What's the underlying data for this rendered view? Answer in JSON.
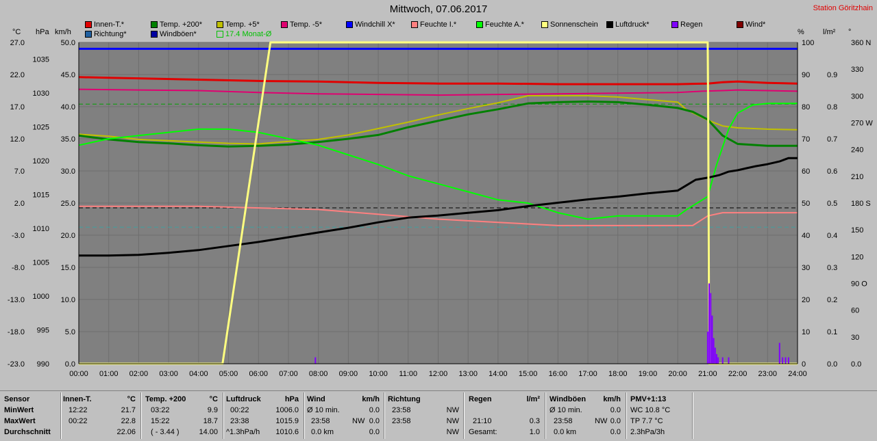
{
  "title": "Mittwoch, 07.06.2017",
  "station": "Station Göritzhain",
  "units": {
    "c": "°C",
    "hpa": "hPa",
    "kmh": "km/h",
    "pct": "%",
    "lm2": "l/m²",
    "deg": "°"
  },
  "legend": [
    {
      "label": "Innen-T.*",
      "color": "#e00000"
    },
    {
      "label": "Temp. +200*",
      "color": "#008000"
    },
    {
      "label": "Temp. +5*",
      "color": "#c0c000"
    },
    {
      "label": "Temp. -5*",
      "color": "#e00070"
    },
    {
      "label": "Windchill X*",
      "color": "#0000ff"
    },
    {
      "label": "Feuchte I.*",
      "color": "#ff8080"
    },
    {
      "label": "Feuchte A.*",
      "color": "#00ff00"
    },
    {
      "label": "Sonnenschein",
      "color": "#ffff80"
    },
    {
      "label": "Luftdruck*",
      "color": "#000000"
    },
    {
      "label": "Regen",
      "color": "#8000ff"
    },
    {
      "label": "Wind*",
      "color": "#800000"
    },
    {
      "label": "Richtung*",
      "color": "#2060a0"
    },
    {
      "label": "Windböen*",
      "color": "#0000a0"
    },
    {
      "label": "17.4 Monat-Ø",
      "color": "#00c000",
      "outline": true
    }
  ],
  "chart_data": {
    "type": "line",
    "x_range": [
      0,
      24
    ],
    "x_ticks": [
      "00:00",
      "01:00",
      "02:00",
      "03:00",
      "04:00",
      "05:00",
      "06:00",
      "07:00",
      "08:00",
      "09:00",
      "10:00",
      "11:00",
      "12:00",
      "13:00",
      "14:00",
      "15:00",
      "16:00",
      "17:00",
      "18:00",
      "19:00",
      "20:00",
      "21:00",
      "22:00",
      "23:00",
      "24:00"
    ],
    "axes": {
      "temp_c": {
        "range": [
          -23,
          27
        ],
        "ticks": [
          "27.0",
          "22.0",
          "17.0",
          "12.0",
          "7.0",
          "2.0",
          "-3.0",
          "-8.0",
          "-13.0",
          "-18.0",
          "-23.0"
        ]
      },
      "pressure_hpa": {
        "range": [
          990,
          1037.5
        ],
        "ticks": [
          "1035",
          "1030",
          "1025",
          "1020",
          "1015",
          "1010",
          "1005",
          "1000",
          "995",
          "990"
        ]
      },
      "wind_kmh": {
        "range": [
          0,
          50
        ],
        "ticks": [
          "50.0",
          "45.0",
          "40.0",
          "35.0",
          "30.0",
          "25.0",
          "20.0",
          "15.0",
          "10.0",
          "5.0",
          "0.0"
        ]
      },
      "humidity_pct": {
        "range": [
          0,
          100
        ],
        "ticks": [
          "100",
          "90",
          "80",
          "70",
          "60",
          "50",
          "40",
          "30",
          "20",
          "10",
          "0"
        ]
      },
      "rain_lm2": {
        "range": [
          0,
          1.0
        ],
        "ticks": [
          "0.9",
          "0.8",
          "0.7",
          "0.6",
          "0.5",
          "0.4",
          "0.3",
          "0.2",
          "0.1",
          "0.0"
        ]
      },
      "direction_deg": {
        "range": [
          0,
          360
        ],
        "ticks": [
          "360 N",
          "330",
          "300",
          "270 W",
          "240",
          "210",
          "180 S",
          "150",
          "120",
          "90 O",
          "60",
          "30",
          "0.0"
        ]
      }
    },
    "grid": true,
    "reference_lines": [
      {
        "axis": "temp_c",
        "value": 17.4,
        "color": "#00a000",
        "dash": true
      },
      {
        "axis": "humidity_pct",
        "value": 48.5,
        "color": "#000000",
        "dash": true
      },
      {
        "axis": "humidity_pct",
        "value": 42.5,
        "color": "#40a0a0",
        "dash": true
      }
    ],
    "series": [
      {
        "name": "Innen-T.*",
        "axis": "temp_c",
        "color": "#e00000",
        "width": 3,
        "x": [
          0,
          1,
          2,
          4,
          6,
          8,
          10,
          12,
          14,
          16,
          18,
          20,
          21,
          21.5,
          22,
          23,
          24
        ],
        "y": [
          21.6,
          21.5,
          21.4,
          21.2,
          21.0,
          20.9,
          20.7,
          20.6,
          20.6,
          20.5,
          20.5,
          20.5,
          20.6,
          20.8,
          20.9,
          20.7,
          20.6
        ]
      },
      {
        "name": "Windböen*",
        "axis": "temp_c",
        "color": "#0000ff",
        "width": 3,
        "x": [
          0,
          24
        ],
        "y": [
          26.0,
          26.0
        ]
      },
      {
        "name": "Temp. -5*",
        "axis": "temp_c",
        "color": "#e00070",
        "width": 2,
        "x": [
          0,
          2,
          4,
          6,
          8,
          10,
          12,
          14,
          16,
          18,
          20,
          20.8,
          21.5,
          22,
          24
        ],
        "y": [
          19.7,
          19.6,
          19.5,
          19.2,
          19.0,
          18.9,
          18.8,
          18.9,
          19.0,
          19.1,
          19.2,
          19.4,
          19.5,
          19.6,
          19.4
        ]
      },
      {
        "name": "Temp. +5*",
        "axis": "temp_c",
        "color": "#c0c000",
        "width": 2,
        "x": [
          0,
          1,
          2,
          3,
          4,
          5,
          6,
          7,
          8,
          9,
          10,
          11,
          12,
          13,
          14,
          15,
          16,
          17,
          18,
          19,
          20,
          20.3,
          21,
          21.5,
          22,
          23,
          24
        ],
        "y": [
          12.7,
          12.4,
          11.9,
          11.7,
          11.5,
          11.3,
          11.2,
          11.6,
          11.9,
          12.6,
          13.6,
          14.6,
          15.7,
          16.7,
          17.6,
          18.7,
          18.7,
          18.7,
          18.5,
          18.1,
          17.7,
          16.5,
          14.9,
          14.0,
          13.7,
          13.5,
          13.4
        ]
      },
      {
        "name": "Temp. +200*",
        "axis": "temp_c",
        "color": "#008000",
        "width": 3,
        "x": [
          0,
          1,
          2,
          3,
          4,
          5,
          6,
          7,
          8,
          9,
          10,
          11,
          12,
          13,
          14,
          15,
          16,
          17,
          18,
          19,
          20,
          20.5,
          21,
          21.5,
          22,
          23,
          24
        ],
        "y": [
          12.5,
          11.9,
          11.5,
          11.3,
          11.0,
          10.8,
          10.9,
          11.1,
          11.5,
          12.0,
          12.6,
          13.8,
          14.8,
          15.8,
          16.6,
          17.5,
          17.7,
          17.8,
          17.7,
          17.3,
          16.8,
          16.2,
          15.0,
          12.5,
          11.2,
          10.9,
          10.9
        ]
      },
      {
        "name": "Feuchte A.*",
        "axis": "humidity_pct",
        "color": "#00ff00",
        "width": 2,
        "x": [
          0,
          1,
          2,
          3,
          4,
          5,
          6,
          7,
          8,
          9,
          10,
          11,
          12,
          13,
          14,
          15,
          16,
          17,
          18,
          19,
          20,
          20.3,
          21,
          21.3,
          21.7,
          22,
          22.5,
          23,
          24
        ],
        "y": [
          68.0,
          70.0,
          71.0,
          72.0,
          73.0,
          73.0,
          72.0,
          70.0,
          68.0,
          65.0,
          62.0,
          58.5,
          56.0,
          53.5,
          51.0,
          50.0,
          47.0,
          45.0,
          46.0,
          46.0,
          46.0,
          48.0,
          52.0,
          62.0,
          73.0,
          78.0,
          80.5,
          81.0,
          81.0
        ]
      },
      {
        "name": "Feuchte I.*",
        "axis": "humidity_pct",
        "color": "#ff8080",
        "width": 2,
        "x": [
          0,
          2,
          4,
          6,
          8,
          10,
          12,
          14,
          16,
          18,
          20,
          20.5,
          21,
          21.5,
          22,
          23,
          24
        ],
        "y": [
          49.0,
          49.0,
          49.0,
          48.5,
          48.0,
          46.5,
          45.0,
          44.0,
          43.0,
          43.0,
          43.0,
          43.0,
          46.0,
          47.0,
          47.0,
          47.0,
          47.0
        ]
      },
      {
        "name": "Luftdruck*",
        "axis": "pressure_hpa",
        "color": "#000000",
        "width": 3,
        "x": [
          0,
          1,
          2,
          3,
          4,
          5,
          6,
          7,
          8,
          9,
          10,
          11,
          12,
          13,
          14,
          15,
          16,
          17,
          18,
          19,
          20,
          20.3,
          20.6,
          21.0,
          21.4,
          21.7,
          22.0,
          22.3,
          22.6,
          23.0,
          23.4,
          23.7,
          24
        ],
        "y": [
          1006.0,
          1006.0,
          1006.1,
          1006.4,
          1006.8,
          1007.4,
          1008.0,
          1008.7,
          1009.4,
          1010.1,
          1010.9,
          1011.6,
          1011.9,
          1012.3,
          1012.7,
          1013.3,
          1013.8,
          1014.3,
          1014.7,
          1015.2,
          1015.6,
          1016.4,
          1017.2,
          1017.5,
          1017.9,
          1018.4,
          1018.6,
          1018.9,
          1019.2,
          1019.5,
          1019.9,
          1020.4,
          1020.4
        ]
      },
      {
        "name": "Sonnenschein",
        "axis": "humidity_pct",
        "color": "#ffff80",
        "width": 3,
        "x": [
          0,
          4.8,
          6.4,
          21.0,
          21.02,
          21.05,
          24
        ],
        "y": [
          0,
          0,
          100,
          100,
          75,
          0,
          0
        ]
      },
      {
        "name": "Regen",
        "axis": "rain_lm2",
        "color": "#8000ff",
        "width": 2,
        "bars": true,
        "x": [
          7.9,
          21.0,
          21.05,
          21.1,
          21.15,
          21.2,
          21.25,
          21.3,
          21.35,
          21.5,
          21.7,
          23.4,
          23.5,
          23.6,
          23.7
        ],
        "y": [
          0.02,
          0.1,
          0.25,
          0.22,
          0.15,
          0.08,
          0.05,
          0.03,
          0.02,
          0.02,
          0.02,
          0.065,
          0.02,
          0.02,
          0.02
        ]
      }
    ]
  },
  "stats": {
    "sensor": {
      "header": "Sensor",
      "rows": [
        "MinWert",
        "MaxWert",
        "Durchschnitt"
      ]
    },
    "innen": {
      "header": "Innen-T.",
      "unit": "°C",
      "rows": [
        [
          "12:22",
          "21.7"
        ],
        [
          "00:22",
          "22.8"
        ],
        [
          "",
          "22.06"
        ]
      ]
    },
    "temp200": {
      "header": "Temp. +200",
      "unit": "°C",
      "rows": [
        [
          "03:22",
          "9.9"
        ],
        [
          "15:22",
          "18.7"
        ],
        [
          "( - 3.44 )",
          "14.00"
        ]
      ]
    },
    "luftdruck": {
      "header": "Luftdruck",
      "unit": "hPa",
      "rows": [
        [
          "00:22",
          "1006.0"
        ],
        [
          "23:38",
          "1015.9"
        ],
        [
          "^1.3hPa/h",
          "1010.6"
        ]
      ]
    },
    "wind": {
      "header": "Wind",
      "unit": "km/h",
      "rows": [
        [
          "Ø 10 min.",
          "",
          "0.0"
        ],
        [
          "23:58",
          "NW",
          "0.0"
        ],
        [
          "0.0 km",
          "",
          "0.0"
        ]
      ]
    },
    "richtung": {
      "header": "Richtung",
      "rows": [
        [
          "23:58",
          "NW"
        ],
        [
          "23:58",
          "NW"
        ],
        [
          "",
          "NW"
        ]
      ]
    },
    "regen": {
      "header": "Regen",
      "unit": "l/m²",
      "rows": [
        [
          "",
          ""
        ],
        [
          "21:10",
          "0.3"
        ],
        [
          "Gesamt:",
          "1.0"
        ]
      ]
    },
    "boeen": {
      "header": "Windböen",
      "unit": "km/h",
      "rows": [
        [
          "Ø 10 min.",
          "",
          "0.0"
        ],
        [
          "23:58",
          "NW",
          "0.0"
        ],
        [
          "0.0 km",
          "",
          "0.0"
        ]
      ]
    },
    "pmv": {
      "header": "PMV+1:13",
      "rows": [
        "WC 10.8 °C",
        "TP 7.7 °C",
        "2.3hPa/3h"
      ]
    }
  }
}
